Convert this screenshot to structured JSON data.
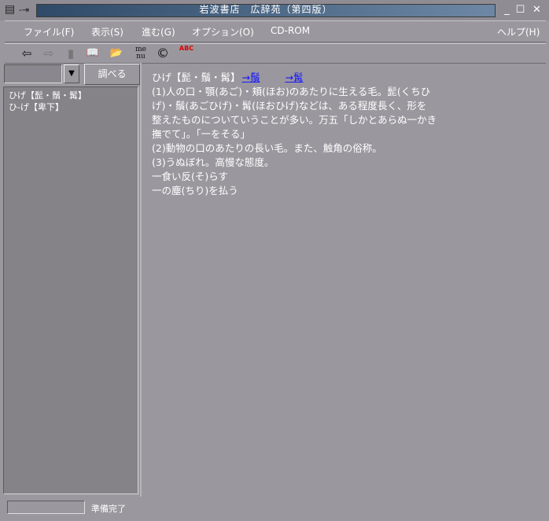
{
  "window": {
    "title": "岩波書店　広辞苑（第四版）",
    "controls": [
      "minimize",
      "maximize",
      "close"
    ]
  },
  "menu": [
    {
      "label": "ファイル(F)"
    },
    {
      "label": "表示(S)"
    },
    {
      "label": "進む(G)"
    },
    {
      "label": "オプション(O)"
    },
    {
      "label": "CD-ROM"
    },
    {
      "label": "ヘルプ(H)"
    }
  ],
  "toolbar": {
    "buttons": [
      {
        "name": "back-arrow-icon",
        "glyph": "⇦"
      },
      {
        "name": "forward-arrow-icon",
        "glyph": "⇨"
      },
      {
        "name": "bookmark-icon",
        "glyph": "▮"
      },
      {
        "name": "book-icon",
        "glyph": "📖"
      },
      {
        "name": "open-folder-icon",
        "glyph": "📂"
      },
      {
        "name": "menu-icon",
        "glyph": "me nu"
      },
      {
        "name": "copyright-icon",
        "glyph": "©"
      },
      {
        "name": "spell-check-icon",
        "glyph": "ABC"
      }
    ]
  },
  "search": {
    "value": "",
    "button_label": "調べる"
  },
  "results": [
    {
      "label": "ひげ【髭・鬚・髯】"
    },
    {
      "label": "ひ-げ【卑下】"
    }
  ],
  "entry": {
    "headword": "ひげ【髭・鬚・髯】",
    "links": [
      "→鬚",
      "→髯"
    ],
    "lines": [
      "(1)人の口・顎(あご)・頬(ほお)のあたりに生える毛。髭(くちひ",
      "げ)・鬚(あごひげ)・髯(ほおひげ)などは、ある程度長く、形を",
      "整えたものについていうことが多い。万五「しかとあらぬ一かき",
      "撫でて」。「一をそる」",
      "(2)動物の口のあたりの長い毛。また、触角の俗称。",
      "(3)うぬぼれ。高慢な態度。",
      "一食い反(そ)らす",
      "一の塵(ちり)を払う"
    ]
  },
  "status": {
    "text": "準備完了"
  }
}
